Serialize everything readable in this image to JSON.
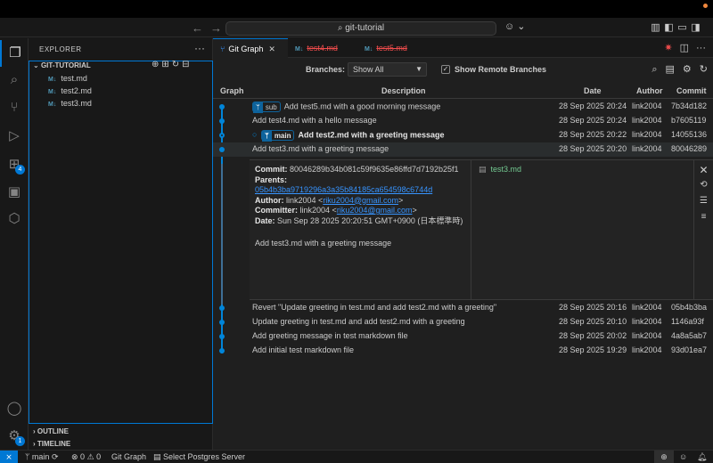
{
  "titlebar": {
    "search": "git-tutorial",
    "back": "←",
    "forward": "→"
  },
  "activity": [
    {
      "name": "explorer-icon",
      "glyph": "❐"
    },
    {
      "name": "search-icon",
      "glyph": "⌕"
    },
    {
      "name": "source-control-icon",
      "glyph": "⑂"
    },
    {
      "name": "run-debug-icon",
      "glyph": "▷"
    },
    {
      "name": "extensions-icon",
      "glyph": "⊞",
      "badge": "4"
    },
    {
      "name": "remote-explorer-icon",
      "glyph": "▣"
    },
    {
      "name": "package-icon",
      "glyph": "⬡"
    }
  ],
  "sidebar": {
    "title": "EXPLORER",
    "section": "GIT-TUTORIAL",
    "files": [
      "test.md",
      "test2.md",
      "test3.md"
    ],
    "outline": "OUTLINE",
    "timeline": "TIMELINE",
    "settings_badge": "1"
  },
  "tabs": [
    {
      "label": "Git Graph",
      "active": true,
      "deleted": false
    },
    {
      "label": "test4.md",
      "active": false,
      "deleted": true
    },
    {
      "label": "test5.md",
      "active": false,
      "deleted": true
    }
  ],
  "gitgraph": {
    "branches_label": "Branches:",
    "branches_value": "Show All",
    "show_remote": "Show Remote Branches",
    "columns": {
      "graph": "Graph",
      "description": "Description",
      "date": "Date",
      "author": "Author",
      "commit": "Commit"
    },
    "commits": [
      {
        "tag": "sub",
        "message": "Add test5.md with a good morning message",
        "date": "28 Sep 2025 20:24",
        "author": "link2004",
        "hash": "7b34d182"
      },
      {
        "tag": "",
        "message": "Add test4.md with a hello message",
        "date": "28 Sep 2025 20:24",
        "author": "link2004",
        "hash": "b7605119"
      },
      {
        "tag": "main",
        "message": "Add test2.md with a greeting message",
        "date": "28 Sep 2025 20:22",
        "author": "link2004",
        "hash": "14055136"
      },
      {
        "tag": "",
        "message": "Add test3.md with a greeting message",
        "date": "28 Sep 2025 20:20",
        "author": "link2004",
        "hash": "80046289"
      },
      {
        "tag": "",
        "message": "Revert \"Update greeting in test.md and add test2.md with a greeting\"",
        "date": "28 Sep 2025 20:16",
        "author": "link2004",
        "hash": "05b4b3ba"
      },
      {
        "tag": "",
        "message": "Update greeting in test.md and add test2.md with a greeting",
        "date": "28 Sep 2025 20:10",
        "author": "link2004",
        "hash": "1146a93f"
      },
      {
        "tag": "",
        "message": "Add greeting message in test markdown file",
        "date": "28 Sep 2025 20:02",
        "author": "link2004",
        "hash": "4a8a5ab7"
      },
      {
        "tag": "",
        "message": "Add initial test markdown file",
        "date": "28 Sep 2025 19:29",
        "author": "link2004",
        "hash": "93d01ea7"
      }
    ],
    "details": {
      "commit_label": "Commit:",
      "commit": "80046289b34b081c59f9635e86ffd7d7192b25f1",
      "parents_label": "Parents:",
      "parents": "05b4b3ba9719296a3a35b84185ca654598c6744d",
      "author_label": "Author:",
      "author_name": "link2004 <",
      "author_email": "riku2004@gmail.com",
      "author_end": ">",
      "committer_label": "Committer:",
      "committer_name": "link2004 <",
      "committer_email": "riku2004@gmail.com",
      "committer_end": ">",
      "date_label": "Date:",
      "date": "Sun Sep 28 2025 20:20:51 GMT+0900 (日本標準時)",
      "body": "Add test3.md with a greeting message",
      "file": "test3.md"
    }
  },
  "status": {
    "branch": "main",
    "errors": "0",
    "warnings": "0",
    "gitgraph": "Git Graph",
    "postgres": "Select Postgres Server"
  },
  "colors": {
    "accent": "#0078d4",
    "graph": "#0085d9",
    "deleted": "#f14c4c",
    "added": "#73c991"
  }
}
